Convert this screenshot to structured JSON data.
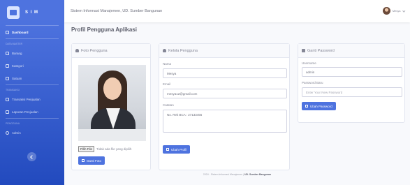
{
  "brand": {
    "name": "S I M"
  },
  "sidebar": {
    "dashboard": "Dashboard",
    "heading_master": "DATA MASTER",
    "item_barang": "Barang",
    "item_kategori": "Kategori",
    "item_satuan": "Satuan",
    "heading_transaksi": "TRANSAKSI",
    "item_transaksi": "Transaksi Penjualan",
    "item_laporan": "Laporan Penjualan",
    "heading_admin": "PENGGUNA",
    "item_admin": "Admin"
  },
  "topbar": {
    "title": "Sistem Informasi Manajemen, UD. Sumber Bangunan",
    "user_name": "Mesya"
  },
  "page": {
    "title": "Profil Pengguna Aplikasi"
  },
  "photo_card": {
    "header": "Foto Pengguna",
    "file_button": "Pilih File",
    "file_status": "Tidak ada file yang dipilih",
    "submit": "Ganti Foto"
  },
  "manage_card": {
    "header": "Kelola Pengguna",
    "name_label": "Nama",
    "name_value": "Mesya",
    "email_label": "Email",
    "email_value": "mesya12@gmail.com",
    "note_label": "Catatan",
    "note_value": "No. Rek BCA : 27133456",
    "submit": "Ubah Profil"
  },
  "password_card": {
    "header": "Ganti Password",
    "username_label": "Username",
    "username_value": "admin",
    "password_label": "Password Baru",
    "password_placeholder": "Enter Your New Password",
    "submit": "Ubah Password"
  },
  "footer": {
    "text": "2024 · Sistem Informasi Manajemen |",
    "company": "UD. Sumber Bangunan"
  },
  "colors": {
    "primary": "#4e73df",
    "sidebar_bottom": "#224abe",
    "background": "#f8f9fc"
  },
  "icons": [
    "gauge-icon",
    "box-icon",
    "tag-icon",
    "scale-icon",
    "cart-icon",
    "report-icon",
    "user-icon",
    "lock-icon",
    "edit-icon",
    "chevron-left-icon",
    "caret-down-icon"
  ]
}
